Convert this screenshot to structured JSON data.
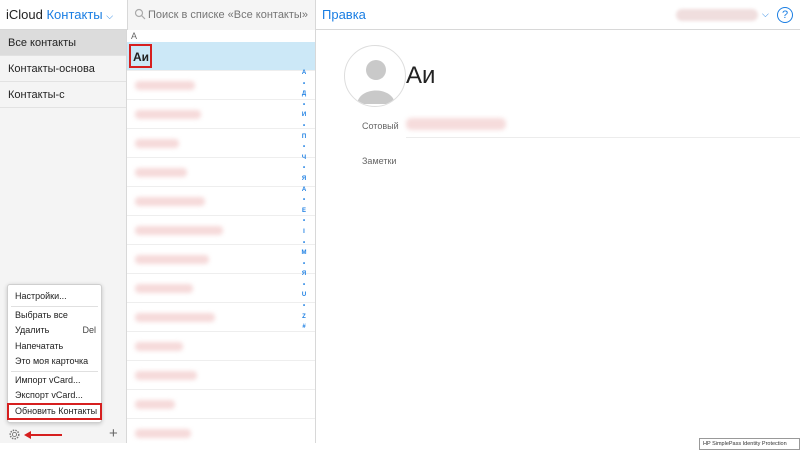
{
  "header": {
    "brand": "iCloud",
    "app_name": "Контакты",
    "search_placeholder": "Поиск в списке «Все контакты»",
    "edit_label": "Правка",
    "help_label": "?"
  },
  "sidebar": {
    "groups": [
      {
        "label": "Все контакты",
        "selected": true
      },
      {
        "label": "Контакты-основа",
        "selected": false
      },
      {
        "label": "Контакты-с",
        "selected": false
      }
    ]
  },
  "menu": {
    "items": {
      "preferences": "Настройки...",
      "select_all": "Выбрать все",
      "delete": "Удалить",
      "delete_shortcut": "Del",
      "print": "Напечатать",
      "my_card": "Это моя карточка",
      "import_vcard": "Импорт vCard...",
      "export_vcard": "Экспорт vCard...",
      "refresh": "Обновить Контакты"
    }
  },
  "footer": {
    "add_label": "+"
  },
  "list": {
    "section_letter": "А",
    "selected_contact": "Аи",
    "index_letters": [
      "А",
      "•",
      "Д",
      "•",
      "И",
      "•",
      "П",
      "•",
      "Ч",
      "•",
      "Я",
      "А",
      "•",
      "E",
      "•",
      "I",
      "•",
      "M",
      "•",
      "Я",
      "•",
      "U",
      "•",
      "Z",
      "#"
    ]
  },
  "detail": {
    "name": "Аи",
    "mobile_label": "Сотовый",
    "notes_label": "Заметки"
  },
  "tooltip": "HP SimplePass Identity Protection",
  "colors": {
    "accent": "#1a7ee3",
    "highlight": "#d61f1f",
    "selection": "#cce8f7"
  }
}
